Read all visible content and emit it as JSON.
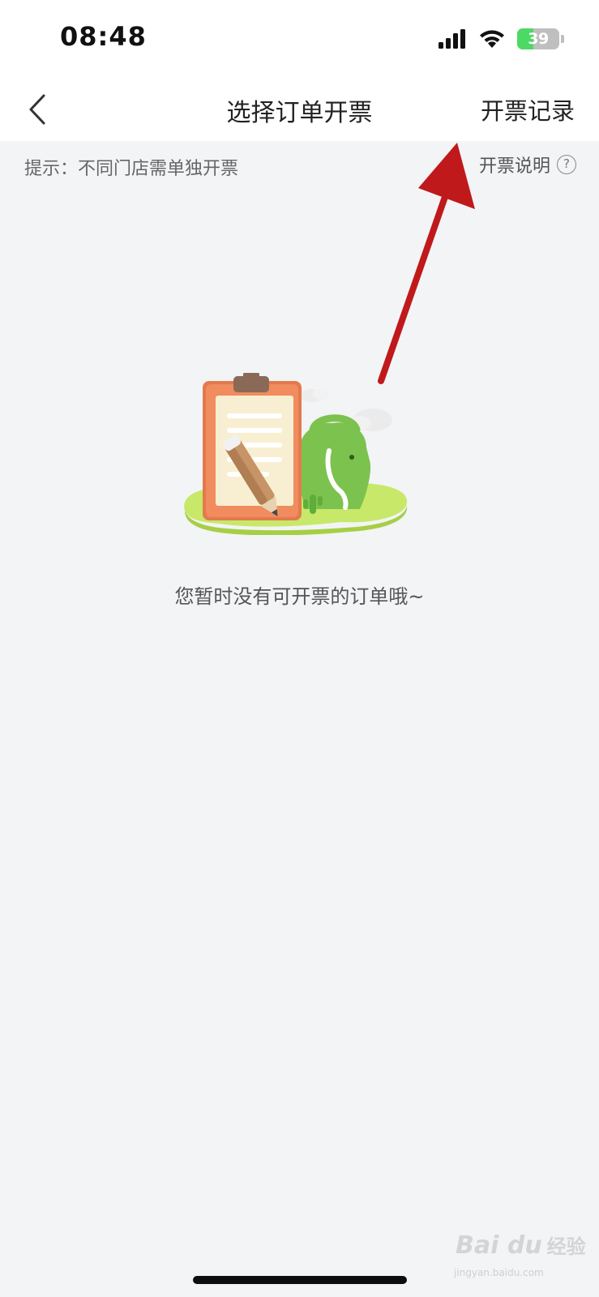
{
  "status_bar": {
    "time": "08:48",
    "battery_level": "39",
    "battery_fraction": 0.39,
    "battery_color": "#4cd964",
    "icons": [
      "signal-icon",
      "wifi-icon",
      "battery-icon"
    ]
  },
  "nav": {
    "back_icon": "chevron-left-icon",
    "title": "选择订单开票",
    "records_label": "开票记录"
  },
  "tip": {
    "text": "提示：不同门店需单独开票",
    "explain_label": "开票说明",
    "help_glyph": "?"
  },
  "empty_state": {
    "illustration": "clipboard-pencil-bag-illustration",
    "message": "您暂时没有可开票的订单哦~"
  },
  "annotation": {
    "arrow_color": "#c0191b",
    "points_to": "records_label"
  },
  "watermark": {
    "logo": "Bai du",
    "name": "经验",
    "url": "jingyan.baidu.com"
  }
}
